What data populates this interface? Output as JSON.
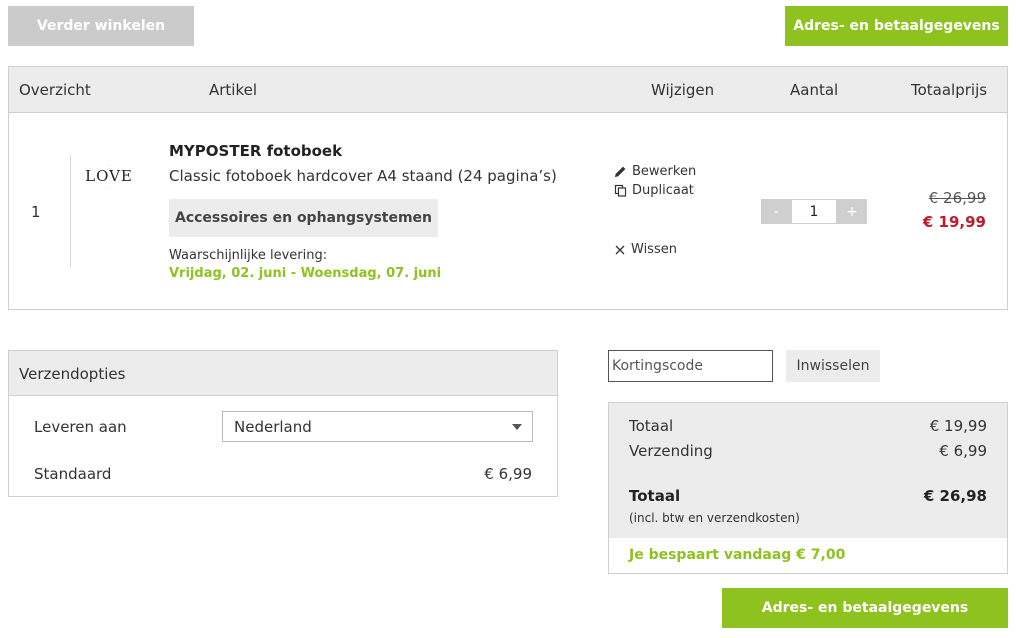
{
  "top_actions": {
    "continue_label": "Verder winkelen",
    "checkout_label": "Adres- en betaalgegevens"
  },
  "cart": {
    "columns": [
      "Overzicht",
      "Artikel",
      "Wijzigen",
      "Aantal",
      "Totaalprijs"
    ],
    "item": {
      "index": "1",
      "thumbnail_text": "LOVE",
      "name": "MYPOSTER fotoboek",
      "description": "Classic fotoboek hardcover A4 staand (24 pagina’s)",
      "accessories_label": "Accessoires en ophangsystemen",
      "delivery_label": "Waarschijnlijke levering:",
      "delivery_dates": "Vrijdag, 02. juni - Woensdag, 07. juni",
      "actions": {
        "edit": "Bewerken",
        "duplicate": "Duplicaat",
        "delete": "Wissen"
      },
      "quantity": "1",
      "qty_minus": "-",
      "qty_plus": "+",
      "price_old": "€ 26,99",
      "price_new": "€ 19,99"
    }
  },
  "shipping": {
    "title": "Verzendopties",
    "deliver_to_label": "Leveren aan",
    "country": "Nederland",
    "standard_label": "Standaard",
    "standard_price": "€ 6,99"
  },
  "coupon": {
    "placeholder": "Kortingscode",
    "button": "Inwisselen"
  },
  "totals": {
    "subtotal_label": "Totaal",
    "subtotal_value": "€ 19,99",
    "shipping_label": "Verzending",
    "shipping_value": "€ 6,99",
    "total_label": "Totaal",
    "total_value": "€ 26,98",
    "total_note": "(incl. btw en verzendkosten)",
    "savings": "Je bespaart vandaag € 7,00"
  },
  "bottom_actions": {
    "checkout_label": "Adres- en betaalgegevens"
  },
  "colors": {
    "accent_green": "#8dc21f",
    "sale_red": "#c01a2c",
    "neutral_grey": "#cbcbcb"
  }
}
